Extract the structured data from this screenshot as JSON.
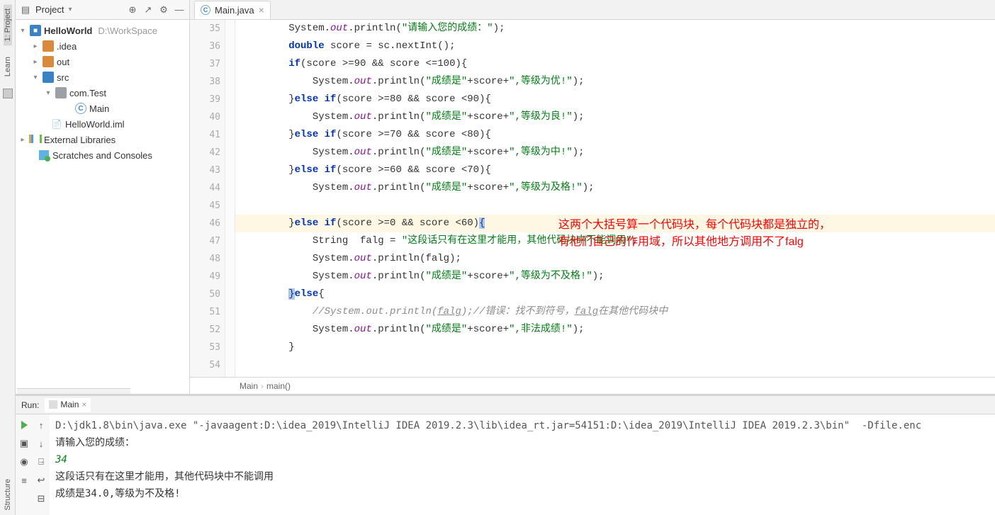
{
  "leftRail": {
    "project": "1: Project",
    "learn": "Learn",
    "structure": "Structure"
  },
  "projectPanel": {
    "title": "Project",
    "root": "HelloWorld",
    "rootPath": "D:\\WorkSpace",
    "nodes": {
      "idea": ".idea",
      "out": "out",
      "src": "src",
      "pkg": "com.Test",
      "main": "Main",
      "iml": "HelloWorld.iml",
      "ext": "External Libraries",
      "scratch": "Scratches and Consoles"
    }
  },
  "editor": {
    "tab": "Main.java",
    "crumbs": [
      "Main",
      "main()"
    ],
    "lines": [
      {
        "n": 35,
        "html": "        System.<span class='fld'>out</span>.println(<span class='str'>\"请输入您的成绩：\"</span>);"
      },
      {
        "n": 36,
        "html": "        <span class='kw'>double</span> score = sc.nextInt();"
      },
      {
        "n": 37,
        "html": "        <span class='kw'>if</span>(score >=90 && score <=100){"
      },
      {
        "n": 38,
        "html": "            System.<span class='fld'>out</span>.println(<span class='str'>\"成绩是\"</span>+score+<span class='str'>\",等级为优!\"</span>);"
      },
      {
        "n": 39,
        "html": "        }<span class='kw'>else if</span>(score >=80 && score <90){"
      },
      {
        "n": 40,
        "html": "            System.<span class='fld'>out</span>.println(<span class='str'>\"成绩是\"</span>+score+<span class='str'>\",等级为良!\"</span>);"
      },
      {
        "n": 41,
        "html": "        }<span class='kw'>else if</span>(score >=70 && score <80){"
      },
      {
        "n": 42,
        "html": "            System.<span class='fld'>out</span>.println(<span class='str'>\"成绩是\"</span>+score+<span class='str'>\",等级为中!\"</span>);"
      },
      {
        "n": 43,
        "html": "        }<span class='kw'>else if</span>(score >=60 && score <70){"
      },
      {
        "n": 44,
        "html": "            System.<span class='fld'>out</span>.println(<span class='str'>\"成绩是\"</span>+score+<span class='str'>\",等级为及格!\"</span>);"
      },
      {
        "n": 45,
        "html": ""
      },
      {
        "n": 46,
        "hl": true,
        "html": "        }<span class='kw'>else if</span>(score >=0 && score <60)<span class='sel'>{</span>"
      },
      {
        "n": 47,
        "html": "            String  falg = <span class='str'>\"这段话只有在这里才能用，其他代码块中不能调用\"</span>;"
      },
      {
        "n": 48,
        "html": "            System.<span class='fld'>out</span>.println(falg);"
      },
      {
        "n": 49,
        "html": "            System.<span class='fld'>out</span>.println(<span class='str'>\"成绩是\"</span>+score+<span class='str'>\",等级为不及格!\"</span>);"
      },
      {
        "n": 50,
        "html": "        <span class='sel'>}</span><span class='kw'>else</span>{"
      },
      {
        "n": 51,
        "html": "            <span class='cmt'>//System.out.println(<u>falg</u>);//错误：找不到符号，<u>falg</u>在其他代码块中</span>"
      },
      {
        "n": 52,
        "html": "            System.<span class='fld'>out</span>.println(<span class='str'>\"成绩是\"</span>+score+<span class='str'>\",非法成绩!\"</span>);"
      },
      {
        "n": 53,
        "html": "        }"
      },
      {
        "n": 54,
        "html": ""
      }
    ]
  },
  "annotation": {
    "line1": "这两个大括号算一个代码块，每个代码块都是独立的，",
    "line2": "有他们自己的作用域，所以其他地方调用不了falg"
  },
  "run": {
    "title": "Run:",
    "tab": "Main",
    "lines": [
      {
        "cls": "cmd",
        "text": "D:\\jdk1.8\\bin\\java.exe \"-javaagent:D:\\idea_2019\\IntelliJ IDEA 2019.2.3\\lib\\idea_rt.jar=54151:D:\\idea_2019\\IntelliJ IDEA 2019.2.3\\bin\"  -Dfile.enc"
      },
      {
        "cls": "",
        "text": "请输入您的成绩："
      },
      {
        "cls": "ci",
        "text": "34"
      },
      {
        "cls": "",
        "text": "这段话只有在这里才能用，其他代码块中不能调用"
      },
      {
        "cls": "",
        "text": "成绩是34.0,等级为不及格!"
      }
    ]
  }
}
